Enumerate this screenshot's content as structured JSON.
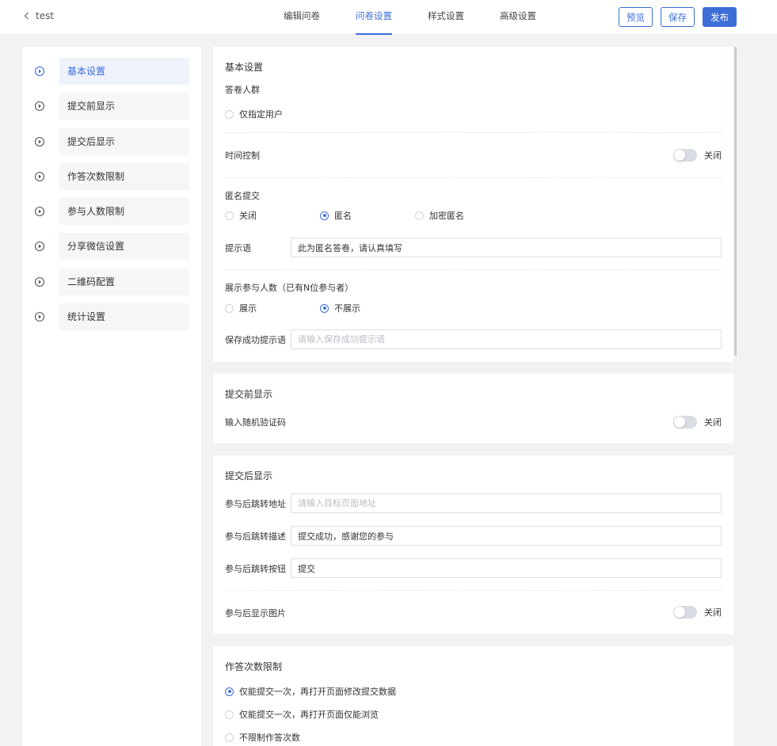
{
  "header": {
    "back_label": "test",
    "tabs": [
      {
        "label": "编辑问卷",
        "active": false
      },
      {
        "label": "问卷设置",
        "active": true
      },
      {
        "label": "样式设置",
        "active": false
      },
      {
        "label": "高级设置",
        "active": false
      }
    ],
    "preview_label": "预览",
    "save_label": "保存",
    "publish_label": "发布",
    "accent_color": "#3d6ed8"
  },
  "sidebar": {
    "items": [
      {
        "label": "基本设置",
        "active": true
      },
      {
        "label": "提交前显示",
        "active": false
      },
      {
        "label": "提交后显示",
        "active": false
      },
      {
        "label": "作答次数限制",
        "active": false
      },
      {
        "label": "参与人数限制",
        "active": false
      },
      {
        "label": "分享微信设置",
        "active": false
      },
      {
        "label": "二维码配置",
        "active": false
      },
      {
        "label": "统计设置",
        "active": false
      }
    ]
  },
  "basic": {
    "title": "基本设置",
    "audience_label": "答卷人群",
    "audience_option": "仅指定用户",
    "time_control_label": "时间控制",
    "time_control_state": "关闭",
    "anonymous_label": "匿名提交",
    "anonymous_options": [
      {
        "label": "关闭",
        "checked": false
      },
      {
        "label": "匿名",
        "checked": true
      },
      {
        "label": "加密匿名",
        "checked": false
      }
    ],
    "prompt_label": "提示语",
    "prompt_value": "此为匿名答卷，请认真填写",
    "show_count_label": "展示参与人数（已有N位参与者）",
    "show_count_options": [
      {
        "label": "展示",
        "checked": false
      },
      {
        "label": "不展示",
        "checked": true
      }
    ],
    "save_tip_label": "保存成功提示语",
    "save_tip_placeholder": "请输入保存成功提示语"
  },
  "before_submit": {
    "title": "提交前显示",
    "captcha_label": "输入随机验证码",
    "captcha_state": "关闭"
  },
  "after_submit": {
    "title": "提交后显示",
    "redirect_url_label": "参与后跳转地址",
    "redirect_url_placeholder": "请输入目标页面地址",
    "redirect_desc_label": "参与后跳转描述",
    "redirect_desc_value": "提交成功，感谢您的参与",
    "redirect_button_label": "参与后跳转按钮",
    "redirect_button_value": "提交",
    "show_image_label": "参与后显示图片",
    "show_image_state": "关闭"
  },
  "answer_limit": {
    "title": "作答次数限制",
    "options": [
      {
        "label": "仅能提交一次，再打开页面修改提交数据",
        "checked": true
      },
      {
        "label": "仅能提交一次，再打开页面仅能浏览",
        "checked": false
      },
      {
        "label": "不限制作答次数",
        "checked": false
      }
    ]
  }
}
